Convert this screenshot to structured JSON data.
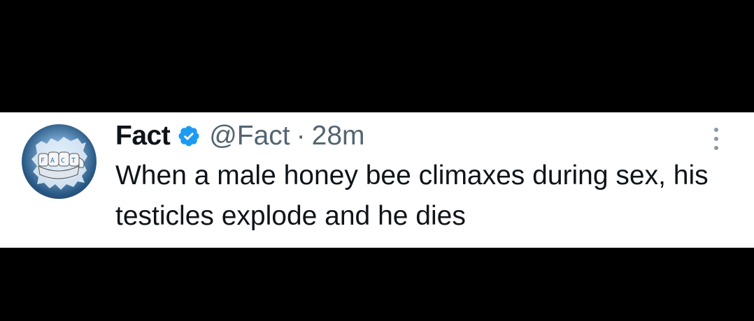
{
  "tweet": {
    "display_name": "Fact",
    "handle": "@Fact",
    "separator": "·",
    "time": "28m",
    "text": "When a male honey bee climaxes during sex, his testicles explode and he dies",
    "avatar_text": "FACT",
    "verified": true
  },
  "icons": {
    "verified": "verified-badge-icon",
    "more": "more-vertical-icon"
  },
  "colors": {
    "background": "#000000",
    "card": "#ffffff",
    "primary_text": "#0f1419",
    "secondary_text": "#536471",
    "verified_blue": "#1d9bf0"
  }
}
